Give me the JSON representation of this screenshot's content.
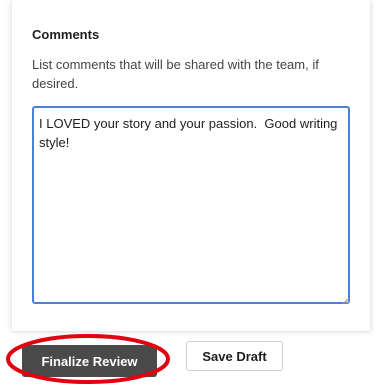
{
  "comments": {
    "heading": "Comments",
    "help_text": "List comments that will be shared with the team, if desired.",
    "value": "I LOVED your story and your passion.  Good writing style!"
  },
  "actions": {
    "finalize_label": "Finalize Review",
    "save_draft_label": "Save Draft"
  },
  "colors": {
    "focus_border": "#4a80dc",
    "primary_button": "#4a4a4a",
    "annotation_circle": "#e3000f"
  }
}
